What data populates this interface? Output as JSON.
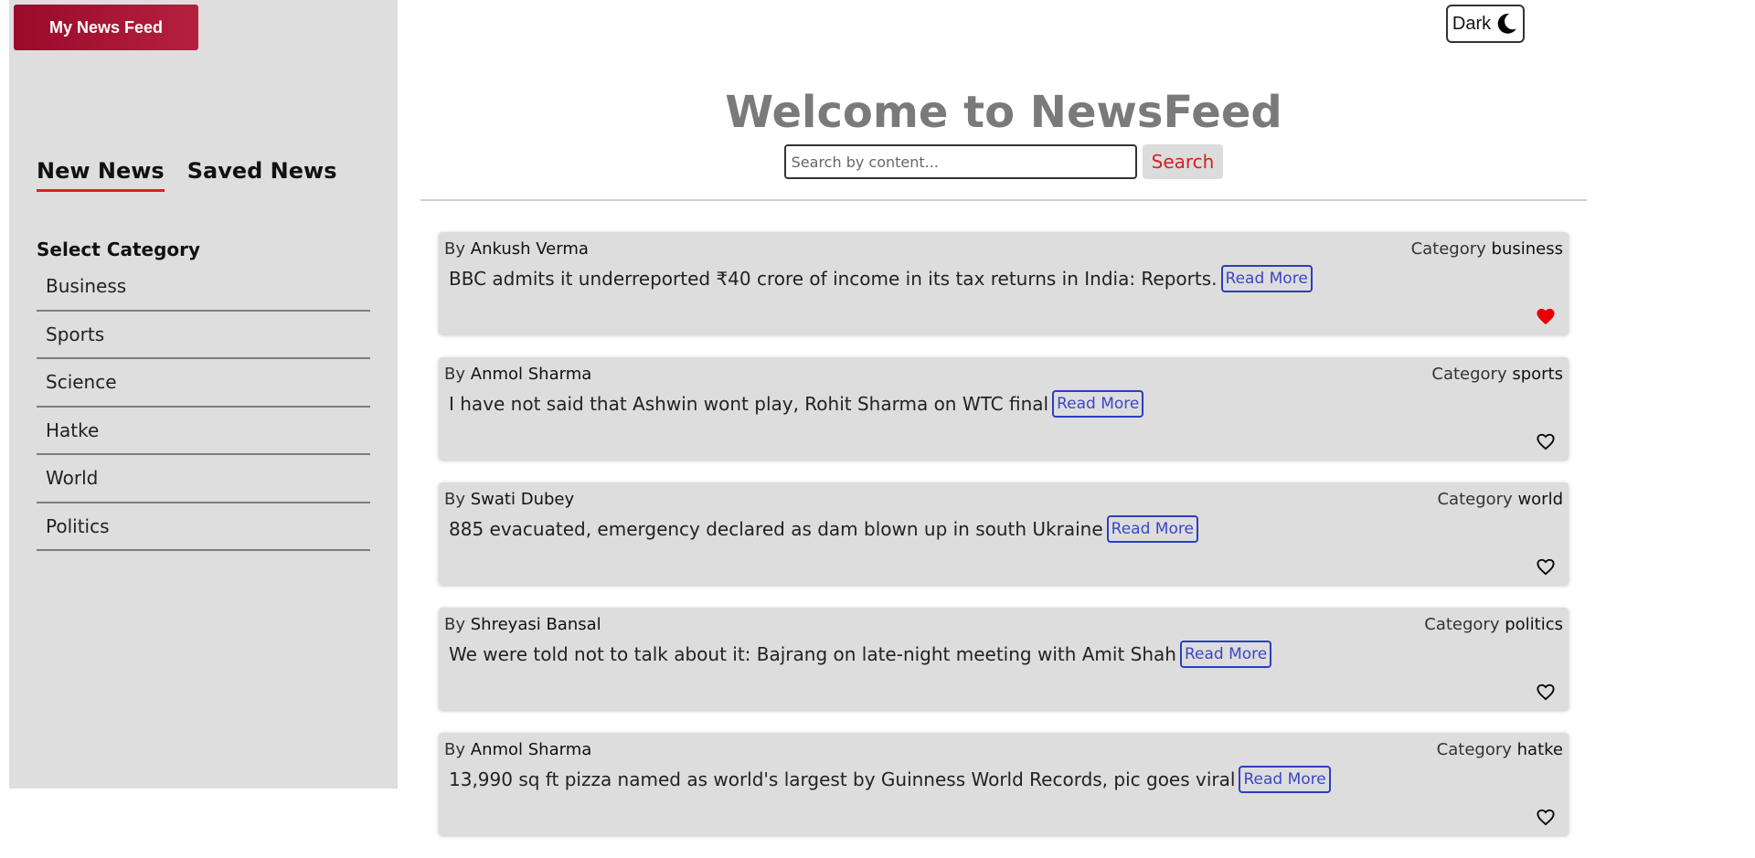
{
  "sidebar": {
    "brand_label": "My News Feed",
    "tabs": [
      {
        "label": "New News",
        "active": true
      },
      {
        "label": "Saved News",
        "active": false
      }
    ],
    "category_title": "Select Category",
    "categories": [
      "Business",
      "Sports",
      "Science",
      "Hatke",
      "World",
      "Politics"
    ]
  },
  "header": {
    "theme_label": "Dark",
    "theme_icon": "moon-icon",
    "welcome": "Welcome to NewsFeed",
    "search_placeholder": "Search by content...",
    "search_button": "Search"
  },
  "feed": {
    "by_label": "By",
    "category_label": "Category",
    "read_more": "Read More",
    "items": [
      {
        "author": "Ankush Verma",
        "category": "business",
        "title": "BBC admits it underreported ₹40 crore of income in its tax returns in India: Reports.",
        "saved": true
      },
      {
        "author": "Anmol Sharma",
        "category": "sports",
        "title": "I have not said that Ashwin wont play, Rohit Sharma on WTC final",
        "saved": false
      },
      {
        "author": "Swati Dubey",
        "category": "world",
        "title": "885 evacuated, emergency declared as dam blown up in south Ukraine",
        "saved": false
      },
      {
        "author": "Shreyasi Bansal",
        "category": "politics",
        "title": "We were told not to talk about it: Bajrang on late-night meeting with Amit Shah",
        "saved": false
      },
      {
        "author": "Anmol Sharma",
        "category": "hatke",
        "title": "13,990 sq ft pizza named as world's largest by Guinness World Records, pic goes viral",
        "saved": false
      }
    ]
  },
  "colors": {
    "accent": "#e01d1d",
    "brand": "#9a0a2b",
    "link": "#3a46c8",
    "heart_filled": "#e60000"
  }
}
